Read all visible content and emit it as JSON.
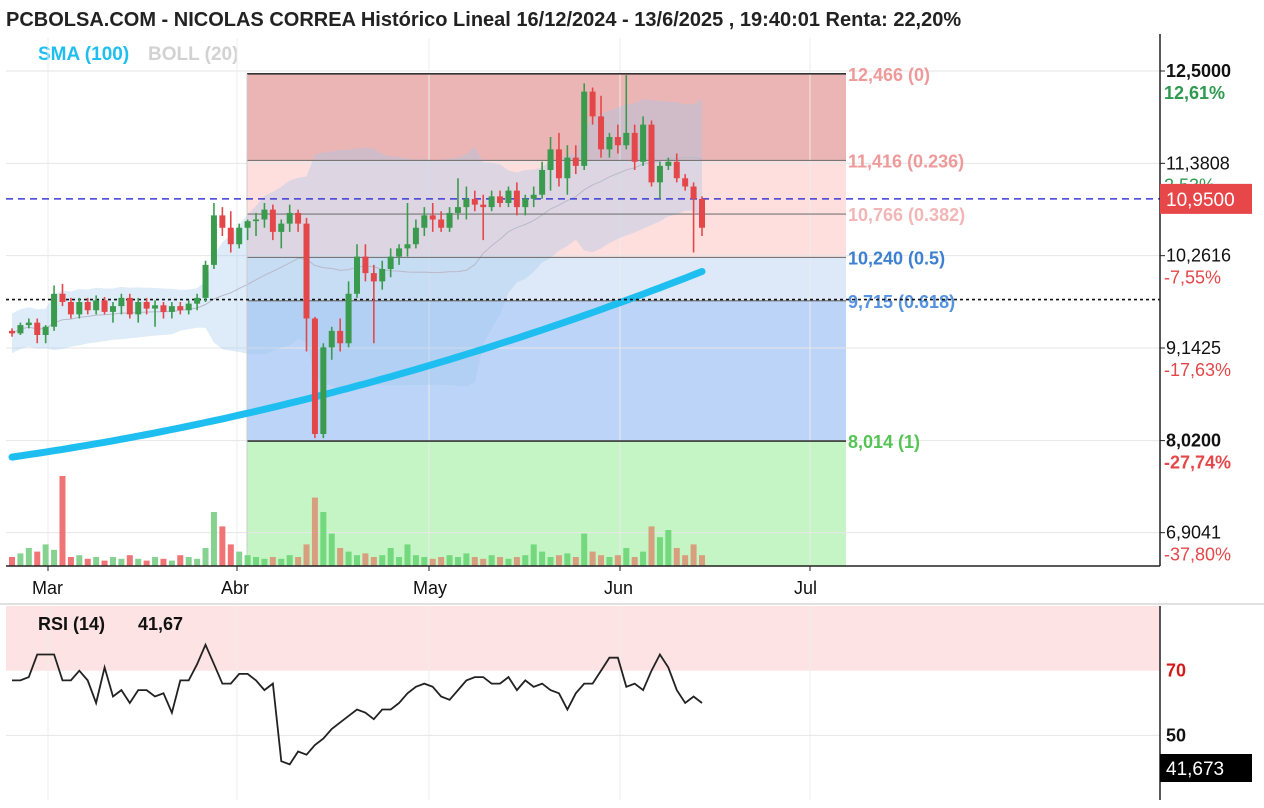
{
  "header": {
    "title": "PCBOLSA.COM - NICOLAS CORREA Histórico Lineal 16/12/2024 - 13/6/2025 , 19:40:01 Renta: 22,20%",
    "sma_label": "SMA (100)",
    "boll_label": "BOLL (20)"
  },
  "colors": {
    "up": "#3a9b4e",
    "down": "#e4474a",
    "sma": "#1ebff0",
    "fib_top": "#e8a8a8",
    "fib_mid": "#ffdede",
    "fib_blue_light": "#dde9f8",
    "fib_blue": "#bcd4f7",
    "fib_green": "#c5f5c5",
    "price_badge": "#e8474a"
  },
  "chart_data": [
    {
      "type": "candlestick",
      "x_axis_labels": [
        "Mar",
        "Abr",
        "May",
        "Jun",
        "Jul"
      ],
      "y_axis": {
        "ylim": [
          6.5,
          12.9
        ],
        "ticks": [
          {
            "price": "12,5000",
            "pct": "12,61%",
            "pct_color": "#2e9a50",
            "bold": true
          },
          {
            "price": "11,3808",
            "pct": "2,53%",
            "pct_color": "#2e9a50",
            "bold": false
          },
          {
            "price": "10,2616",
            "pct": "-7,55%",
            "pct_color": "#e4474a",
            "bold": false
          },
          {
            "price": "9,1425",
            "pct": "-17,63%",
            "pct_color": "#e4474a",
            "bold": false
          },
          {
            "price": "8,0200",
            "pct": "-27,74%",
            "pct_color": "#e4474a",
            "bold": true
          },
          {
            "price": "6,9041",
            "pct": "-37,80%",
            "pct_color": "#e4474a",
            "bold": false
          }
        ]
      },
      "last_price_label": "10,9500",
      "last_price": 10.95,
      "reference_price": 9.73,
      "fibonacci": [
        {
          "label": "12,466 (0)",
          "value": 12.466,
          "color": "#ee9a9a"
        },
        {
          "label": "11,416 (0.236)",
          "value": 11.416,
          "color": "#ee9a9a"
        },
        {
          "label": "10,766 (0.382)",
          "value": 10.766,
          "color": "#f2b6b6"
        },
        {
          "label": "10,240 (0.5)",
          "value": 10.24,
          "color": "#3d7fd0"
        },
        {
          "label": "9,715 (0.618)",
          "value": 9.715,
          "color": "#5592e0"
        },
        {
          "label": "8,014 (1)",
          "value": 8.014,
          "color": "#55c455"
        }
      ],
      "candles": [
        [
          9.35,
          9.38,
          9.28,
          9.32
        ],
        [
          9.32,
          9.45,
          9.3,
          9.42
        ],
        [
          9.42,
          9.5,
          9.38,
          9.45
        ],
        [
          9.45,
          9.5,
          9.2,
          9.3
        ],
        [
          9.3,
          9.42,
          9.2,
          9.4
        ],
        [
          9.4,
          9.9,
          9.35,
          9.8
        ],
        [
          9.8,
          9.92,
          9.65,
          9.7
        ],
        [
          9.7,
          9.75,
          9.5,
          9.55
        ],
        [
          9.55,
          9.75,
          9.5,
          9.7
        ],
        [
          9.7,
          9.75,
          9.55,
          9.6
        ],
        [
          9.6,
          9.78,
          9.55,
          9.72
        ],
        [
          9.72,
          9.76,
          9.55,
          9.58
        ],
        [
          9.58,
          9.7,
          9.45,
          9.65
        ],
        [
          9.65,
          9.8,
          9.55,
          9.75
        ],
        [
          9.75,
          9.8,
          9.5,
          9.55
        ],
        [
          9.55,
          9.75,
          9.45,
          9.7
        ],
        [
          9.7,
          9.75,
          9.55,
          9.62
        ],
        [
          9.62,
          9.72,
          9.4,
          9.66
        ],
        [
          9.66,
          9.7,
          9.5,
          9.58
        ],
        [
          9.58,
          9.7,
          9.5,
          9.65
        ],
        [
          9.65,
          9.7,
          9.55,
          9.6
        ],
        [
          9.6,
          9.72,
          9.55,
          9.68
        ],
        [
          9.68,
          9.8,
          9.6,
          9.75
        ],
        [
          9.75,
          10.2,
          9.7,
          10.15
        ],
        [
          10.15,
          10.9,
          10.1,
          10.75
        ],
        [
          10.75,
          10.85,
          10.5,
          10.6
        ],
        [
          10.6,
          10.8,
          10.3,
          10.4
        ],
        [
          10.4,
          10.65,
          10.35,
          10.6
        ],
        [
          10.6,
          10.7,
          10.45,
          10.68
        ],
        [
          10.68,
          10.78,
          10.5,
          10.7
        ],
        [
          10.7,
          10.9,
          10.6,
          10.82
        ],
        [
          10.82,
          10.88,
          10.45,
          10.55
        ],
        [
          10.55,
          10.7,
          10.35,
          10.65
        ],
        [
          10.65,
          10.88,
          10.55,
          10.78
        ],
        [
          10.78,
          10.82,
          10.55,
          10.65
        ],
        [
          10.65,
          10.72,
          9.1,
          9.5
        ],
        [
          9.5,
          9.52,
          8.05,
          8.1
        ],
        [
          8.1,
          9.2,
          8.05,
          9.15
        ],
        [
          9.15,
          9.4,
          9.0,
          9.35
        ],
        [
          9.35,
          9.5,
          9.1,
          9.2
        ],
        [
          9.2,
          9.95,
          9.15,
          9.8
        ],
        [
          9.8,
          10.4,
          9.75,
          10.25
        ],
        [
          10.25,
          10.4,
          9.95,
          10.05
        ],
        [
          10.05,
          10.15,
          9.2,
          9.95
        ],
        [
          9.95,
          10.2,
          9.85,
          10.1
        ],
        [
          10.1,
          10.35,
          10.0,
          10.25
        ],
        [
          10.25,
          10.4,
          10.15,
          10.35
        ],
        [
          10.35,
          10.9,
          10.25,
          10.4
        ],
        [
          10.4,
          10.7,
          10.35,
          10.6
        ],
        [
          10.6,
          10.85,
          10.5,
          10.75
        ],
        [
          10.75,
          10.9,
          10.55,
          10.7
        ],
        [
          10.7,
          10.8,
          10.55,
          10.6
        ],
        [
          10.6,
          10.85,
          10.55,
          10.78
        ],
        [
          10.78,
          11.2,
          10.7,
          10.85
        ],
        [
          10.85,
          11.1,
          10.7,
          10.95
        ],
        [
          10.95,
          11.05,
          10.8,
          10.88
        ],
        [
          10.88,
          11.0,
          10.45,
          10.85
        ],
        [
          10.85,
          11.05,
          10.8,
          10.98
        ],
        [
          10.98,
          11.05,
          10.85,
          10.9
        ],
        [
          10.9,
          11.1,
          10.85,
          11.05
        ],
        [
          11.05,
          11.15,
          10.75,
          10.85
        ],
        [
          10.85,
          11.0,
          10.75,
          10.95
        ],
        [
          10.95,
          11.1,
          10.85,
          11.0
        ],
        [
          11.0,
          11.4,
          10.95,
          11.3
        ],
        [
          11.3,
          11.7,
          11.05,
          11.55
        ],
        [
          11.55,
          11.75,
          11.1,
          11.2
        ],
        [
          11.2,
          11.6,
          11.0,
          11.45
        ],
        [
          11.45,
          11.6,
          11.25,
          11.35
        ],
        [
          11.35,
          12.35,
          11.3,
          12.25
        ],
        [
          12.25,
          12.3,
          11.85,
          11.95
        ],
        [
          11.95,
          12.2,
          11.45,
          11.55
        ],
        [
          11.55,
          11.75,
          11.45,
          11.7
        ],
        [
          11.7,
          11.85,
          11.5,
          11.6
        ],
        [
          11.6,
          12.45,
          11.55,
          11.75
        ],
        [
          11.75,
          11.85,
          11.3,
          11.4
        ],
        [
          11.4,
          11.95,
          11.35,
          11.85
        ],
        [
          11.85,
          11.9,
          11.1,
          11.15
        ],
        [
          11.15,
          11.4,
          10.95,
          11.35
        ],
        [
          11.35,
          11.45,
          11.3,
          11.4
        ],
        [
          11.4,
          11.5,
          11.15,
          11.2
        ],
        [
          11.2,
          11.25,
          11.05,
          11.1
        ],
        [
          11.1,
          11.15,
          10.3,
          10.95
        ],
        [
          10.95,
          10.98,
          10.5,
          10.6
        ]
      ],
      "volumes": [
        0.05,
        0.07,
        0.1,
        0.08,
        0.12,
        0.09,
        0.5,
        0.05,
        0.06,
        0.04,
        0.05,
        0.03,
        0.05,
        0.04,
        0.06,
        0.04,
        0.03,
        0.05,
        0.04,
        0.03,
        0.06,
        0.05,
        0.04,
        0.1,
        0.3,
        0.22,
        0.12,
        0.08,
        0.06,
        0.05,
        0.04,
        0.05,
        0.04,
        0.06,
        0.05,
        0.12,
        0.38,
        0.3,
        0.18,
        0.1,
        0.08,
        0.06,
        0.07,
        0.05,
        0.06,
        0.1,
        0.05,
        0.12,
        0.06,
        0.05,
        0.04,
        0.05,
        0.06,
        0.05,
        0.07,
        0.05,
        0.04,
        0.06,
        0.05,
        0.04,
        0.05,
        0.06,
        0.12,
        0.08,
        0.05,
        0.06,
        0.07,
        0.05,
        0.18,
        0.08,
        0.06,
        0.05,
        0.06,
        0.1,
        0.05,
        0.08,
        0.22,
        0.16,
        0.2,
        0.1,
        0.06,
        0.12,
        0.06
      ]
    },
    {
      "type": "line",
      "title": "RSI (14)",
      "value_label": "41,67",
      "last_value_label": "41,673",
      "ylim": [
        30,
        90
      ],
      "threshold_labels": [
        "70",
        "50"
      ],
      "thresholds": [
        70,
        50
      ],
      "values": [
        67,
        67,
        68,
        75,
        75,
        75,
        67,
        67,
        70,
        67,
        60,
        71,
        62,
        64,
        60,
        64,
        64,
        62,
        63,
        57,
        67,
        67,
        72,
        78,
        72,
        66,
        66,
        69,
        69,
        67,
        64,
        66,
        42,
        41,
        45,
        44,
        47,
        49,
        52,
        54,
        56,
        58,
        57,
        55,
        58,
        58,
        60,
        63,
        65,
        66,
        65,
        62,
        61,
        64,
        67,
        68,
        68,
        66,
        66,
        68,
        64,
        67,
        65,
        66,
        64,
        63,
        58,
        63,
        66,
        66,
        70,
        74,
        74,
        65,
        66,
        64,
        70,
        75,
        71,
        64,
        60,
        62,
        60
      ]
    }
  ]
}
